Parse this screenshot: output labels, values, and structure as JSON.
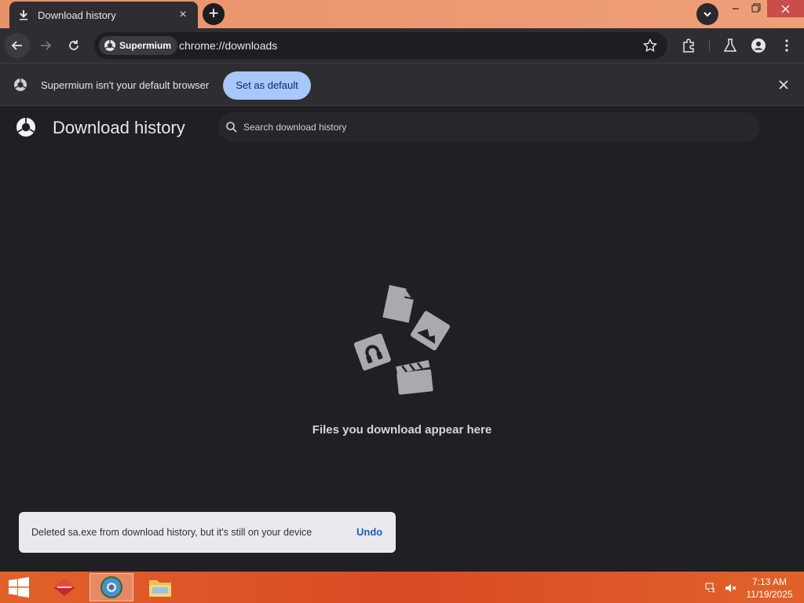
{
  "browser": {
    "tab_title": "Download history",
    "tab_close": "×",
    "new_tab": "+",
    "chip_label": "Supermium",
    "url": "chrome://downloads"
  },
  "infobar": {
    "message": "Supermium isn't your default browser",
    "button": "Set as default"
  },
  "page": {
    "title": "Download history",
    "search_placeholder": "Search download history",
    "empty_message": "Files you download appear here"
  },
  "toast": {
    "message": "Deleted sa.exe from download history, but it's still on your device",
    "action": "Undo"
  },
  "taskbar": {
    "time": "7:13 AM",
    "date": "11/19/2025"
  },
  "colors": {
    "titlebar": "#ee9f78",
    "toolbar": "#2e2e32",
    "page_bg": "#1f1f24",
    "accent_button": "#a8c7fa",
    "taskbar": "#d94a25"
  }
}
